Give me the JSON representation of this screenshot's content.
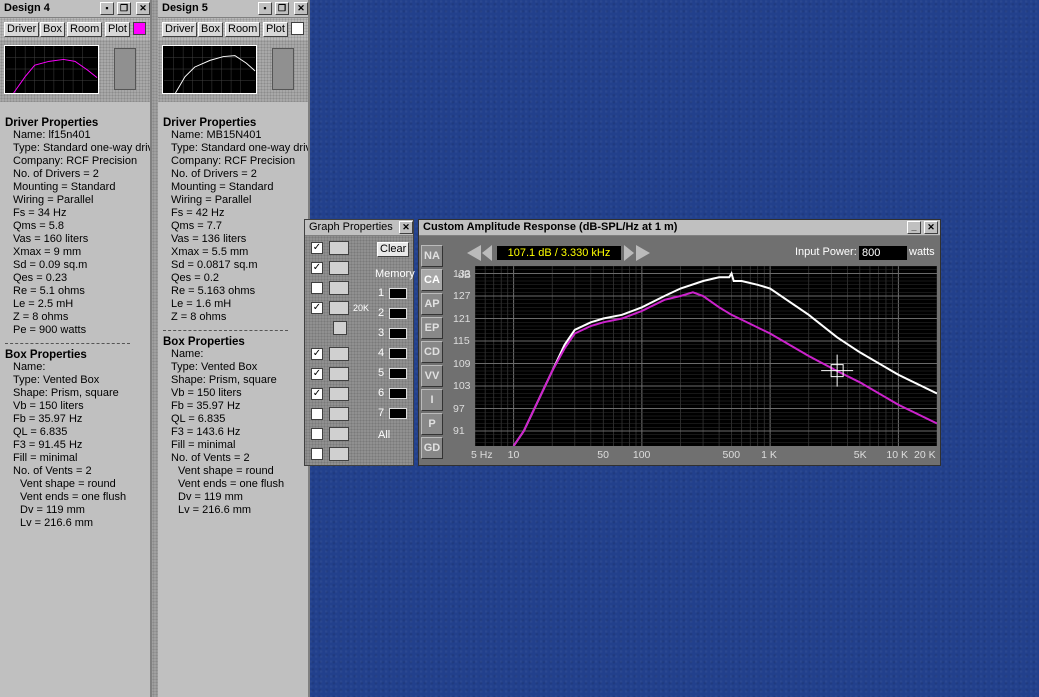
{
  "design4": {
    "title": "Design 4",
    "toolbar": [
      "Driver",
      "Box",
      "Room",
      "Plot"
    ],
    "color": "#ff00ff",
    "driver_heading": "Driver Properties",
    "driver": [
      "Name: lf15n401",
      "Type: Standard one-way driv",
      "Company: RCF Precision",
      "No. of Drivers = 2",
      "Mounting = Standard",
      "Wiring = Parallel",
      "Fs =  34 Hz",
      "Qms =  5.8",
      "Vas =  160 liters",
      "Xmax =  9 mm",
      "Sd =  0.09 sq.m",
      "Qes =  0.23",
      "Re =  5.1 ohms",
      "Le =  2.5 mH",
      "Z =  8 ohms",
      "Pe =  900 watts"
    ],
    "box_heading": "Box Properties",
    "box": [
      "Name:",
      "Type: Vented Box",
      "Shape: Prism, square",
      "Vb =  150 liters",
      "Fb =  35.97 Hz",
      "QL =  6.835",
      "F3 =  91.45 Hz",
      "Fill = minimal",
      "No. of Vents = 2"
    ],
    "vent": [
      "Vent shape = round",
      "Vent ends = one flush",
      "Dv =  119 mm",
      "Lv =  216.6 mm"
    ]
  },
  "design5": {
    "title": "Design 5",
    "toolbar": [
      "Driver",
      "Box",
      "Room",
      "Plot"
    ],
    "color": "#ffffff",
    "driver_heading": "Driver Properties",
    "driver": [
      "Name: MB15N401",
      "Type: Standard one-way driv",
      "Company: RCF Precision",
      "No. of Drivers = 2",
      "Mounting = Standard",
      "Wiring = Parallel",
      "Fs =  42 Hz",
      "Qms =  7.7",
      "Vas =  136 liters",
      "Xmax =  5.5 mm",
      "Sd =  0.0817 sq.m",
      "Qes =  0.2",
      "Re =  5.163 ohms",
      "Le =  1.6 mH",
      "Z =  8 ohms"
    ],
    "box_heading": "Box Properties",
    "box": [
      "Name:",
      "Type: Vented Box",
      "Shape: Prism, square",
      "Vb =  150 liters",
      "Fb =  35.97 Hz",
      "QL =  6.835",
      "F3 =  143.6 Hz",
      "Fill = minimal",
      "No. of Vents = 2"
    ],
    "vent": [
      "Vent shape = round",
      "Vent ends = one flush",
      "Dv =  119 mm",
      "Lv =  216.6 mm"
    ]
  },
  "graph_props": {
    "title": "Graph Properties",
    "clear": "Clear",
    "memory": "Memory",
    "slots": [
      "1",
      "2",
      "3",
      "4",
      "5",
      "6",
      "7"
    ],
    "all": "All",
    "icon_20k": "20K"
  },
  "chart_window": {
    "title": "Custom Amplitude Response (dB-SPL/Hz at 1 m)",
    "readout": "107.1 dB / 3.330 kHz",
    "input_power_label": "Input Power:",
    "input_power": "800",
    "watts": "watts",
    "tabs": [
      "NA",
      "CA",
      "AP",
      "EP",
      "CD",
      "VV",
      "I",
      "P",
      "GD"
    ],
    "active_tab": "CA"
  },
  "chart_data": {
    "type": "line",
    "ylabel": "dB",
    "yticks": [
      "133",
      "127",
      "121",
      "115",
      "109",
      "103",
      "97",
      "91"
    ],
    "xticks": [
      "5 Hz",
      "10",
      "50",
      "100",
      "500",
      "1 K",
      "5K",
      "10 K",
      "20 K"
    ],
    "xscale": "log",
    "xlim": [
      5,
      20000
    ],
    "ylim": [
      87,
      135
    ],
    "grid": true,
    "series": [
      {
        "color": "#ffffff",
        "x": [
          10,
          12,
          15,
          20,
          25,
          30,
          40,
          50,
          70,
          100,
          150,
          200,
          300,
          400,
          450,
          480,
          500,
          520,
          600,
          800,
          1000,
          2000,
          3330,
          5000,
          10000,
          20000
        ],
        "y": [
          87,
          91,
          98,
          107,
          114,
          118,
          120,
          121,
          122,
          124,
          127,
          129,
          131,
          132,
          132,
          132,
          133,
          131,
          131,
          130,
          129,
          122,
          116,
          112,
          106,
          101
        ]
      },
      {
        "color": "#cc22cc",
        "x": [
          10,
          12,
          15,
          20,
          25,
          30,
          40,
          50,
          70,
          100,
          150,
          200,
          250,
          300,
          400,
          500,
          1000,
          2000,
          3330,
          5000,
          10000,
          20000
        ],
        "y": [
          87,
          91,
          98,
          107,
          113,
          117,
          119,
          120,
          121,
          123,
          126,
          127,
          128,
          127,
          124,
          122,
          117,
          111,
          107,
          104,
          98,
          93
        ]
      }
    ]
  }
}
